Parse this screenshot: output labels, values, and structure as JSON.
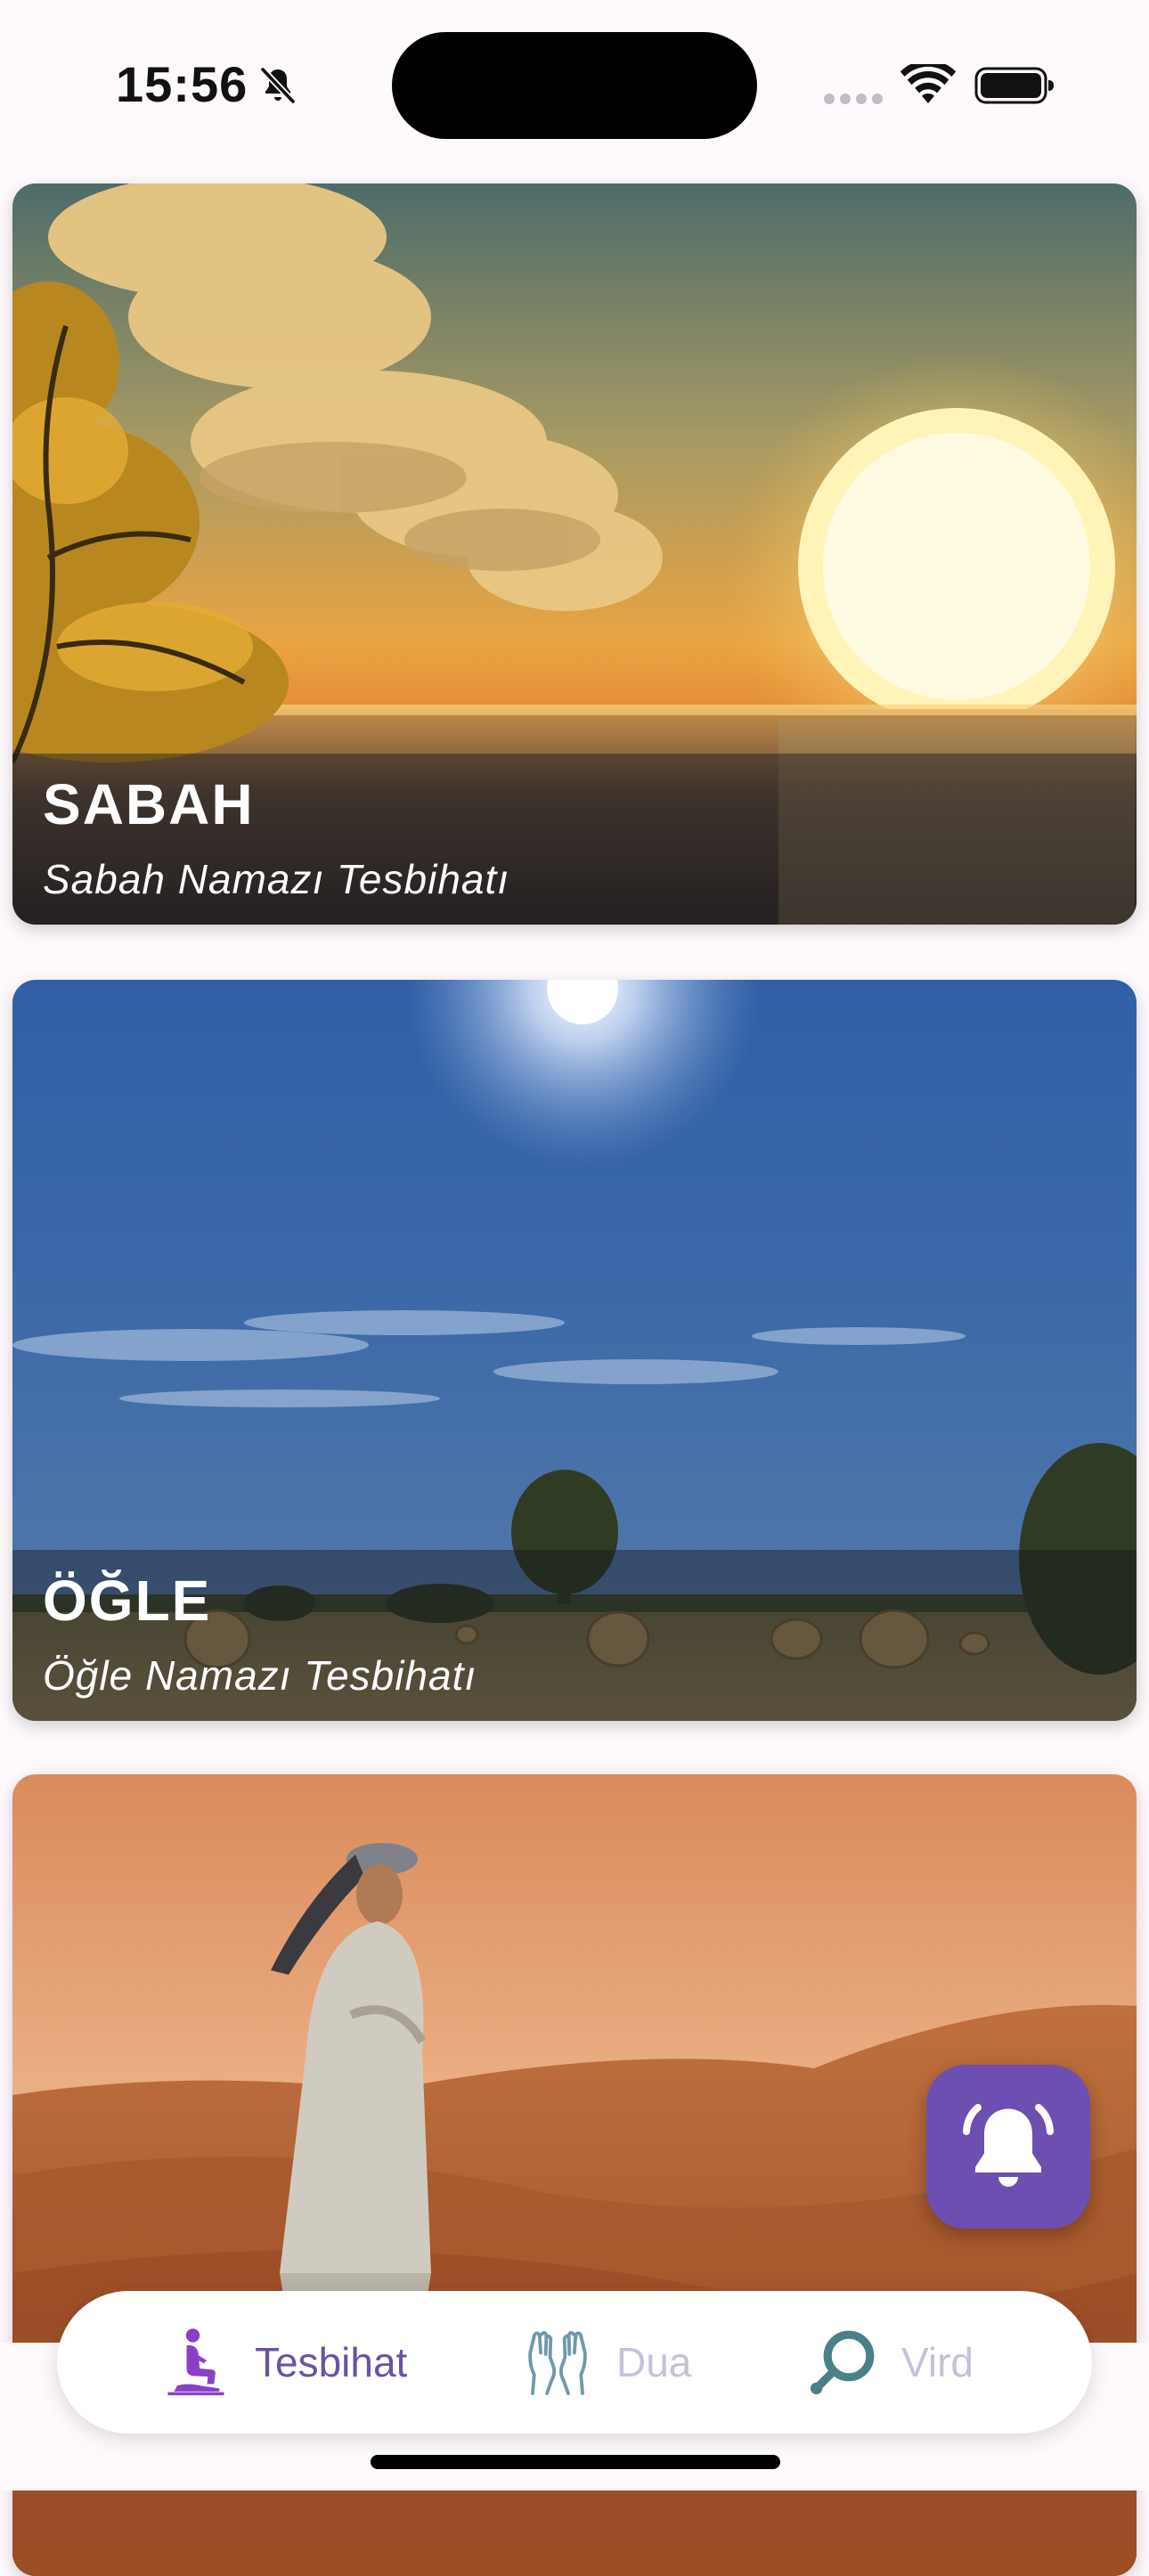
{
  "status_bar": {
    "time": "15:56"
  },
  "cards": [
    {
      "title": "SABAH",
      "subtitle": "Sabah Namazı Tesbihatı"
    },
    {
      "title": "ÖĞLE",
      "subtitle": "Öğle Namazı Tesbihatı"
    },
    {
      "title": "",
      "subtitle": ""
    }
  ],
  "fab": {
    "icon": "bell-ring-icon",
    "color": "#6c4fb0"
  },
  "bottom_nav": {
    "items": [
      {
        "label": "Tesbihat",
        "icon": "praying-person-icon",
        "active": true
      },
      {
        "label": "Dua",
        "icon": "praying-hands-icon",
        "active": false
      },
      {
        "label": "Vird",
        "icon": "tasbih-beads-icon",
        "active": false
      }
    ],
    "active_color": "#6a52a6",
    "inactive_color": "#c7c0d8"
  }
}
